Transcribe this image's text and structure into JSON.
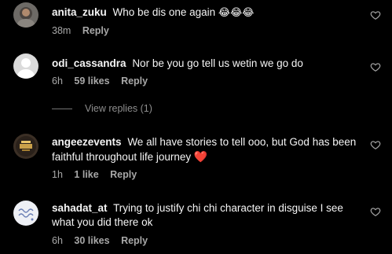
{
  "colors": {
    "background": "#000000",
    "text": "#f5f5f5",
    "muted": "#a8a8a8",
    "heart": "#e0245e"
  },
  "comments": [
    {
      "username": "anita_zuku",
      "text": "Who be dis one again",
      "emoji": "😂😂😂",
      "time": "38m",
      "likes": "",
      "reply_label": "Reply",
      "avatar_icon": "profile-photo-avatar-icon"
    },
    {
      "username": "odi_cassandra",
      "text": "Nor be you go tell us wetin we go do",
      "time": "6h",
      "likes": "59 likes",
      "reply_label": "Reply",
      "avatar_icon": "default-avatar-icon"
    },
    {
      "username": "angeezevents",
      "text": "We all have stories to tell ooo, but God has been faithful throughout life journey",
      "emoji": "❤️",
      "time": "1h",
      "likes": "1 like",
      "reply_label": "Reply",
      "avatar_icon": "logo-avatar-icon"
    },
    {
      "username": "sahadat_at",
      "text": "Trying to justify chi chi character in disguise I see what you did there ok",
      "time": "6h",
      "likes": "30 likes",
      "reply_label": "Reply",
      "avatar_icon": "script-logo-avatar-icon"
    }
  ],
  "view_replies_label": "View replies (1)",
  "like_icon": "heart-outline-icon"
}
